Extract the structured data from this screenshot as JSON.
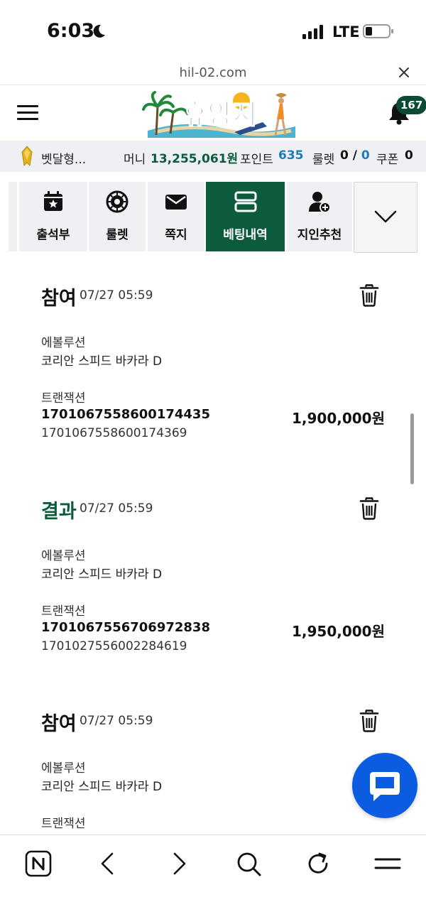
{
  "status_bar": {
    "time": "6:03",
    "network": "LTE"
  },
  "browser": {
    "url": "hil-02.com"
  },
  "header": {
    "logo_text": "휴양지",
    "notification_count": "167"
  },
  "user_info": {
    "name": "벳달형...",
    "money_label": "머니",
    "money_value": "13,255,061원",
    "point_label": "포인트",
    "point_value": "635",
    "roulette_label": "룰렛",
    "roulette_value_a": "0 /",
    "roulette_value_b": "0",
    "coupon_label": "쿠폰",
    "coupon_value": "0"
  },
  "quick_menu": {
    "items": [
      {
        "label": "출석부",
        "icon": "calendar-star-icon"
      },
      {
        "label": "룰렛",
        "icon": "roulette-icon"
      },
      {
        "label": "쪽지",
        "icon": "envelope-icon"
      },
      {
        "label": "베팅내역",
        "icon": "list-stack-icon",
        "active": true
      },
      {
        "label": "지인추천",
        "icon": "user-add-icon"
      }
    ],
    "more_icon": "chevron-down-icon"
  },
  "entries": [
    {
      "status": "참여",
      "time": "07/27 05:59",
      "provider_label": "에볼루션",
      "game": "코리안 스피드 바카라 D",
      "tx_label": "트랜잭션",
      "tx_id_1": "1701067558600174435",
      "tx_id_2": "1701067558600174369",
      "amount": "1,900,000원"
    },
    {
      "status": "결과",
      "time": "07/27 05:59",
      "provider_label": "에볼루션",
      "game": "코리안 스피드 바카라 D",
      "tx_label": "트랜잭션",
      "tx_id_1": "1701067556706972838",
      "tx_id_2": "1701027556002284619",
      "amount": "1,950,000원"
    },
    {
      "status": "참여",
      "time": "07/27 05:59",
      "provider_label": "에볼루션",
      "game": "코리안 스피드 바카라 D",
      "tx_label": "트랜잭션",
      "tx_id_1": "",
      "tx_id_2": "",
      "amount": ""
    }
  ],
  "colors": {
    "brand_green": "#0b5b3c",
    "point_blue": "#1f7ab8",
    "chat_blue": "#0b5ce0"
  }
}
